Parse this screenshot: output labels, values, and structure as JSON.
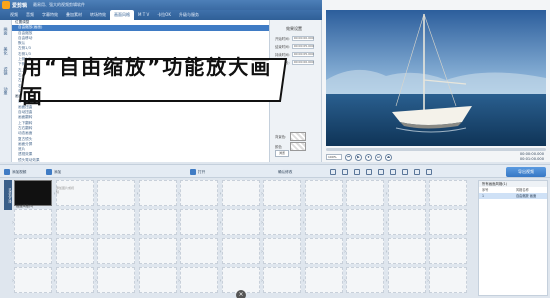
{
  "window": {
    "app_name": "爱剪辑",
    "subtitle": "最易用、强大的视频剪辑软件",
    "controls": [
      "—",
      "□",
      "×"
    ]
  },
  "menu": {
    "tabs": [
      "视频",
      "音频",
      "字幕特效",
      "叠加素材",
      "转场特效",
      "画面风格",
      "M T V",
      "卡拉OK",
      "升级与服务"
    ],
    "active": "画面风格"
  },
  "side_tabs": [
    "画面",
    "美化",
    "滤镜",
    "动景"
  ],
  "effects": {
    "items": [
      {
        "label": "位置调整",
        "group": true
      },
      {
        "label": "自由缩放(画面)",
        "selected": true
      },
      {
        "label": "自由缩放"
      },
      {
        "label": "自由移动"
      },
      {
        "label": "默认"
      },
      {
        "label": "左侧1/3"
      },
      {
        "label": "右侧1/3"
      },
      {
        "label": "上侧1/3"
      },
      {
        "label": "下侧1/3"
      },
      {
        "label": "左上角"
      },
      {
        "label": "右上角"
      },
      {
        "label": "左下角"
      },
      {
        "label": "右下角"
      },
      {
        "label": "中间"
      },
      {
        "label": "画面旋转",
        "group": true
      },
      {
        "label": "自动裁剪"
      },
      {
        "label": "画面扭曲"
      },
      {
        "label": "自动扭曲"
      },
      {
        "label": "画面翻转"
      },
      {
        "label": "上下翻转"
      },
      {
        "label": "左右翻转"
      },
      {
        "label": "动态画面"
      },
      {
        "label": "复古镜头"
      },
      {
        "label": "画面分屏"
      },
      {
        "label": "底片"
      },
      {
        "label": "透视效果"
      },
      {
        "label": "镜头晃动效果"
      }
    ]
  },
  "settings": {
    "title": "效果设置",
    "rows": [
      {
        "label": "开始时间:",
        "value": "00:00:00.000"
      },
      {
        "label": "结束时间:",
        "value": "00:00:05.000"
      },
      {
        "label": "持续时间:",
        "value": "00:00:05.000"
      },
      {
        "label": "特效时长:",
        "value": "00:00:00.000"
      }
    ],
    "bg_label": "背景色:",
    "color_label": "颜色",
    "browse_label": "浏览"
  },
  "banner": {
    "text": "用“自由缩放”功能放大画面"
  },
  "preview": {
    "zoom": "100%",
    "time_current": "00:00:00.000",
    "time_total": "00:01:00.000",
    "buttons": [
      "⏮",
      "▶",
      "⏹",
      "⏭",
      "⏏"
    ]
  },
  "toolbar": {
    "add_video": "添加视频",
    "add_audio": "添加",
    "confirm_effect": "确认修改",
    "open_effect": "打开",
    "export": "导出视频"
  },
  "timeline": {
    "clip_caption": "画面风格(1)",
    "ghost_text": "添加图片或视频",
    "track_label": "已添加片段"
  },
  "right_panel": {
    "title": "所有画面风格(1)",
    "col_index": "序号",
    "col_name": "风格名称",
    "rows": [
      {
        "index": "1",
        "name": "自由缩放 画面"
      }
    ]
  }
}
